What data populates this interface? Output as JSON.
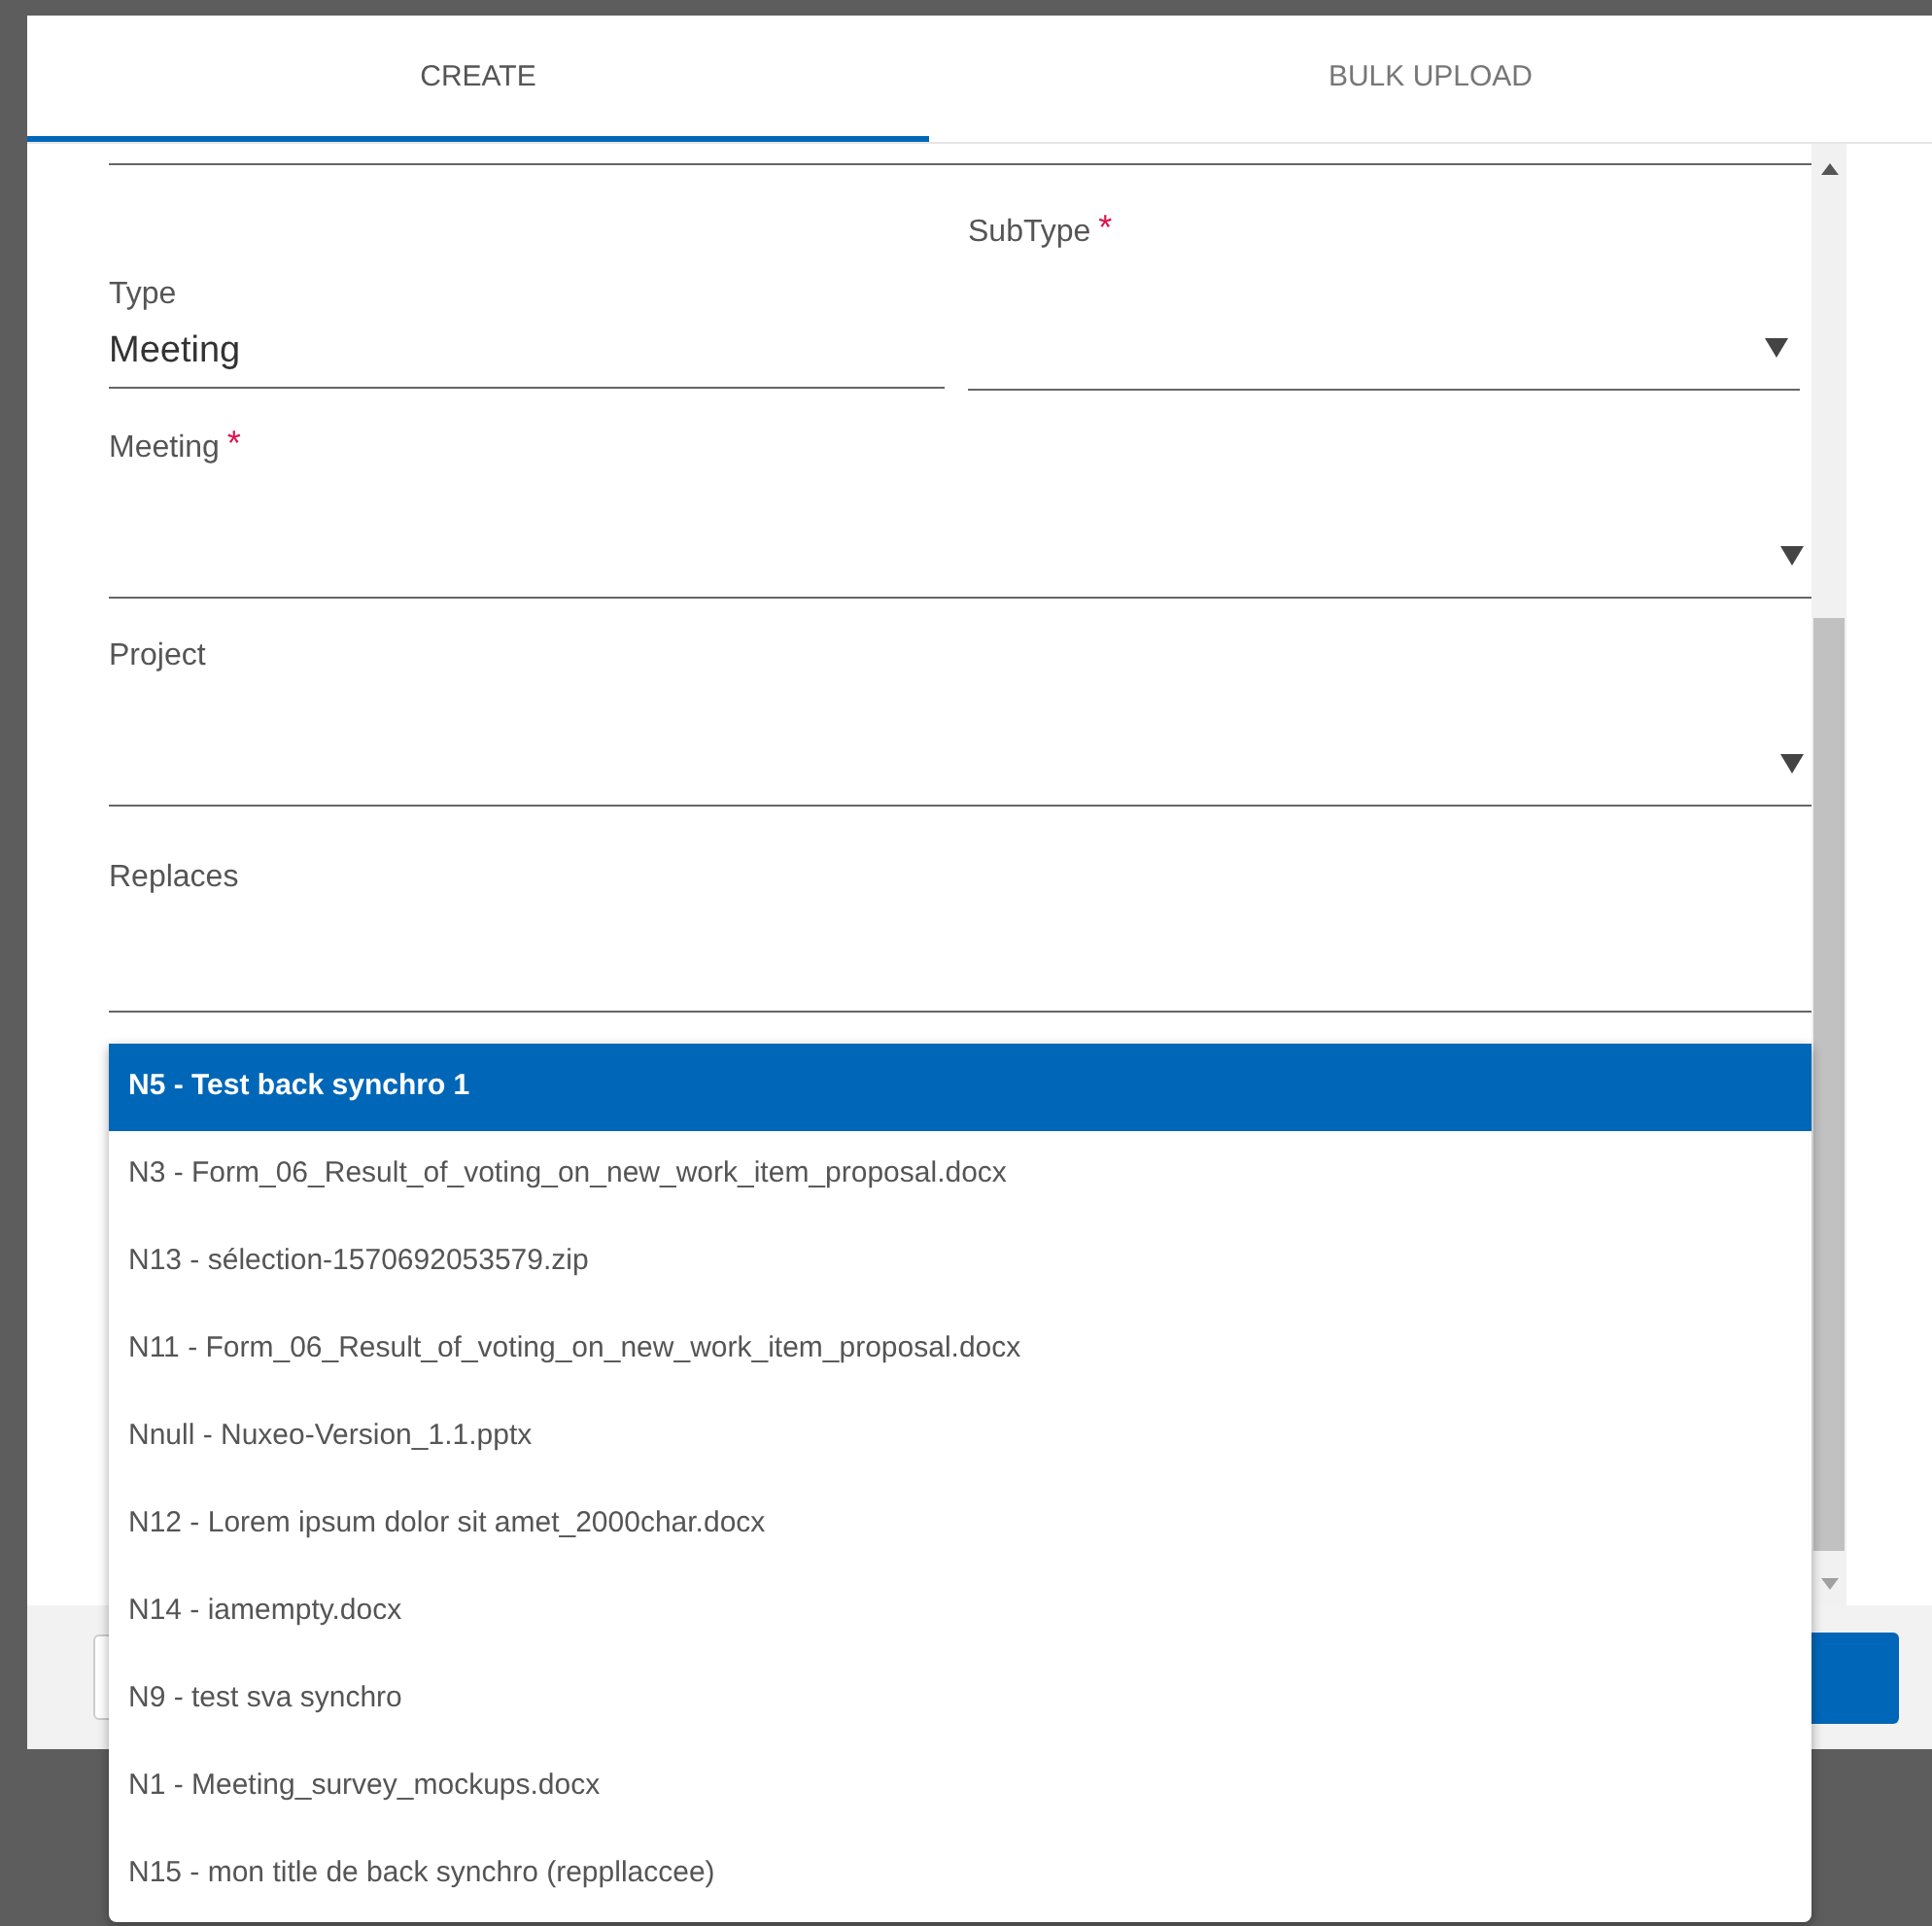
{
  "tabs": [
    {
      "label": "CREATE",
      "selected": true
    },
    {
      "label": "BULK UPLOAD",
      "selected": false
    }
  ],
  "fields": [
    {
      "kind": "text",
      "label": "Type",
      "value": "Meeting"
    },
    {
      "kind": "select",
      "label": "SubType",
      "required_mark": "*"
    },
    {
      "kind": "select",
      "label": "Meeting",
      "required_mark": "*"
    },
    {
      "kind": "select",
      "label": "Project"
    },
    {
      "kind": "autocomplete",
      "label": "Replaces"
    }
  ],
  "replaces_options": [
    {
      "label": "N5 - Test back synchro 1",
      "selected": true
    },
    {
      "label": "N3 - Form_06_Result_of_voting_on_new_work_item_proposal.docx",
      "selected": false
    },
    {
      "label": "N13 - sélection-1570692053579.zip",
      "selected": false
    },
    {
      "label": "N11 - Form_06_Result_of_voting_on_new_work_item_proposal.docx",
      "selected": false
    },
    {
      "label": "Nnull - Nuxeo-Version_1.1.pptx",
      "selected": false
    },
    {
      "label": "N12 - Lorem ipsum dolor sit amet_2000char.docx",
      "selected": false
    },
    {
      "label": "N14 - iamempty.docx",
      "selected": false
    },
    {
      "label": "N9 - test sva synchro",
      "selected": false
    },
    {
      "label": "N1 - Meeting_survey_mockups.docx",
      "selected": false
    },
    {
      "label": "N15 - mon title de back synchro (reppllaccee)",
      "selected": false
    }
  ]
}
